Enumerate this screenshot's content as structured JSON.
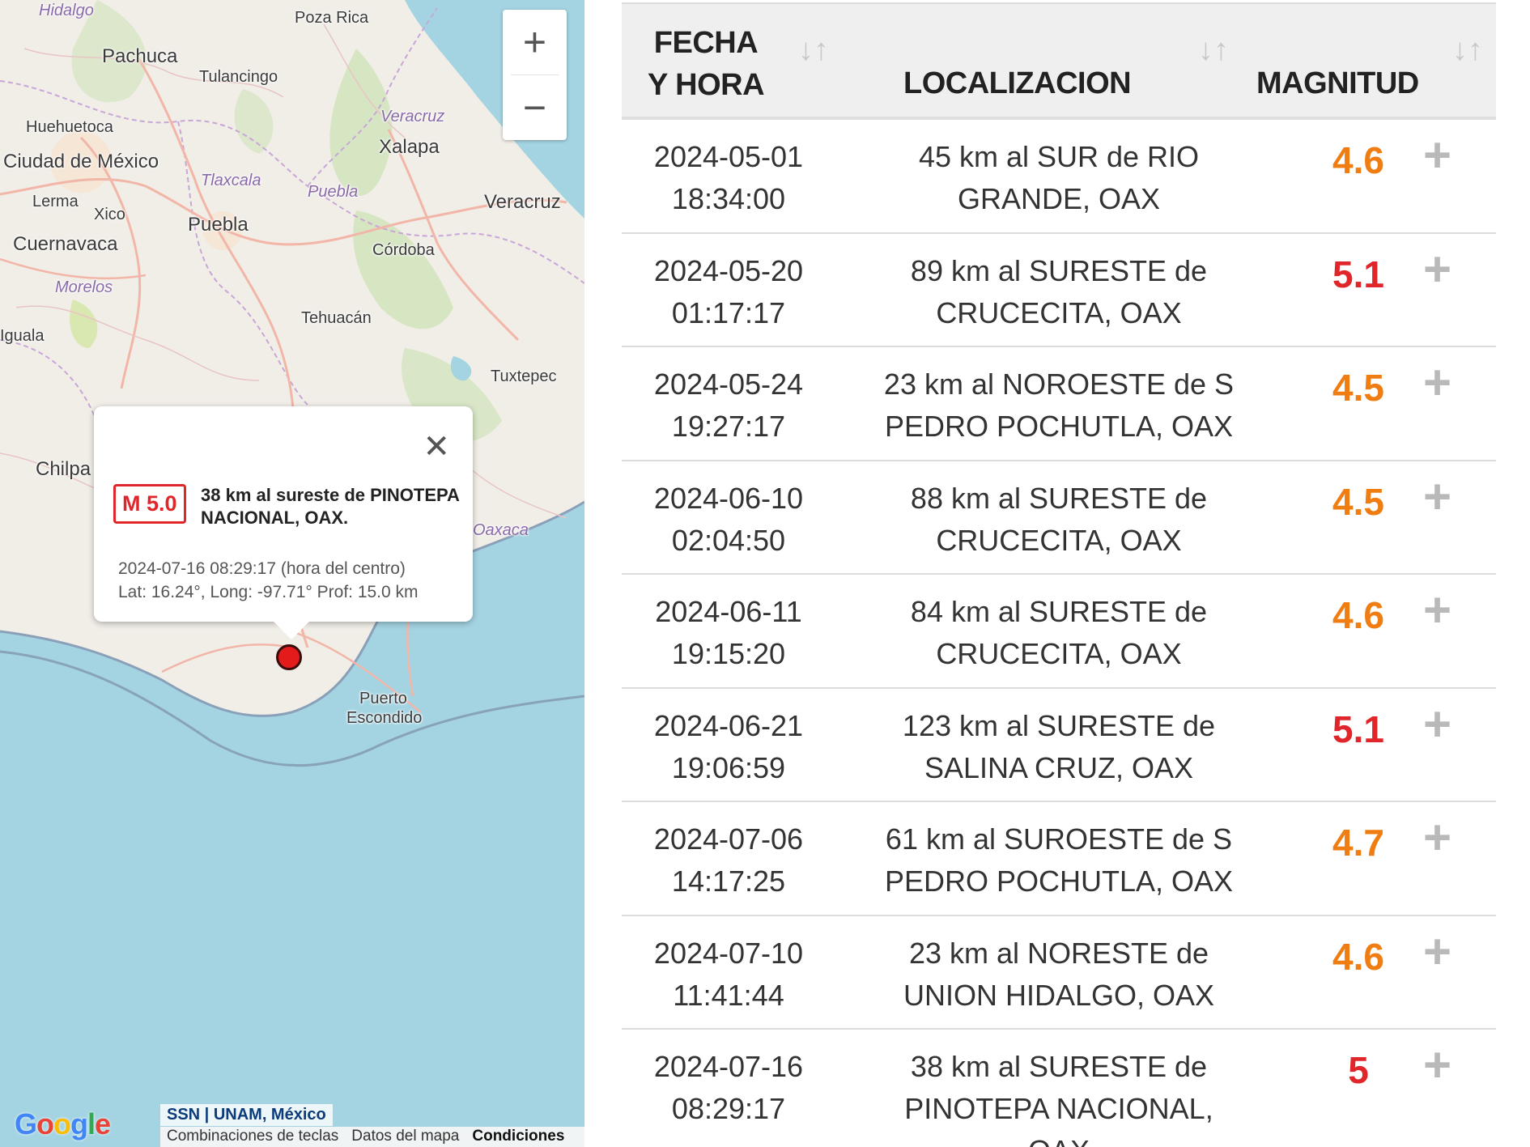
{
  "map": {
    "places": {
      "hidalgo": "Hidalgo",
      "pachuca": "Pachuca",
      "poza_rica": "Poza Rica",
      "tulancingo": "Tulancingo",
      "huehuetoca": "Huehuetoca",
      "veracruz_state": "Veracruz",
      "xalapa": "Xalapa",
      "ciudad_de_mexico": "Ciudad de México",
      "tlaxcala": "Tlaxcala",
      "puebla_state": "Puebla",
      "veracruz_city": "Veracruz",
      "lerma": "Lerma",
      "xico": "Xico",
      "puebla_city": "Puebla",
      "cuernavaca": "Cuernavaca",
      "cordoba": "Córdoba",
      "morelos": "Morelos",
      "tehuacan": "Tehuacán",
      "iguala": "Iguala",
      "tuxtepec": "Tuxtepec",
      "chilpa": "Chilpa",
      "oaxaca": "Oaxaca",
      "puerto": "Puerto",
      "escondido": "Escondido"
    },
    "zoom_in": "+",
    "zoom_out": "−",
    "popup": {
      "close": "✕",
      "magnitude": "M 5.0",
      "title": "38 km al sureste de PINOTEPA NACIONAL, OAX.",
      "datetime": "2024-07-16   08:29:17 (hora del centro)",
      "coords": "Lat: 16.24°, Long: -97.71°  Prof: 15.0 km"
    },
    "attribution": "SSN | UNAM, México",
    "footer_links": [
      "Combinaciones de teclas",
      "Datos del mapa",
      "Condiciones"
    ],
    "google": [
      "G",
      "o",
      "o",
      "g",
      "l",
      "e"
    ]
  },
  "table": {
    "headers": {
      "fecha": "FECHA Y HORA",
      "localizacion": "LOCALIZACION",
      "magnitud": "MAGNITUD",
      "sort_icon": "↓↑"
    },
    "expand_icon": "+",
    "colors": {
      "orange": "#f07d12",
      "red": "#e0262b"
    },
    "rows": [
      {
        "date": "2024-05-01",
        "time": "18:34:00",
        "loc1": "45 km al SUR de RIO",
        "loc2": "GRANDE, OAX",
        "mag": "4.6",
        "color": "#f07d12"
      },
      {
        "date": "2024-05-20",
        "time": "01:17:17",
        "loc1": "89 km al SURESTE de",
        "loc2": "CRUCECITA, OAX",
        "mag": "5.1",
        "color": "#e0262b"
      },
      {
        "date": "2024-05-24",
        "time": "19:27:17",
        "loc1": "23 km al NOROESTE de S",
        "loc2": "PEDRO POCHUTLA, OAX",
        "mag": "4.5",
        "color": "#f07d12"
      },
      {
        "date": "2024-06-10",
        "time": "02:04:50",
        "loc1": "88 km al SURESTE de",
        "loc2": "CRUCECITA, OAX",
        "mag": "4.5",
        "color": "#f07d12"
      },
      {
        "date": "2024-06-11",
        "time": "19:15:20",
        "loc1": "84 km al SURESTE de",
        "loc2": "CRUCECITA, OAX",
        "mag": "4.6",
        "color": "#f07d12"
      },
      {
        "date": "2024-06-21",
        "time": "19:06:59",
        "loc1": "123 km al SURESTE de",
        "loc2": "SALINA CRUZ, OAX",
        "mag": "5.1",
        "color": "#e0262b"
      },
      {
        "date": "2024-07-06",
        "time": "14:17:25",
        "loc1": "61 km al SUROESTE de S",
        "loc2": "PEDRO POCHUTLA, OAX",
        "mag": "4.7",
        "color": "#f07d12"
      },
      {
        "date": "2024-07-10",
        "time": "11:41:44",
        "loc1": "23 km al NORESTE de",
        "loc2": "UNION HIDALGO, OAX",
        "mag": "4.6",
        "color": "#f07d12"
      },
      {
        "date": "2024-07-16",
        "time": "08:29:17",
        "loc1": "38 km al SURESTE de",
        "loc2": "PINOTEPA NACIONAL,",
        "loc3": "OAX",
        "mag": "5",
        "color": "#e0262b"
      }
    ]
  }
}
